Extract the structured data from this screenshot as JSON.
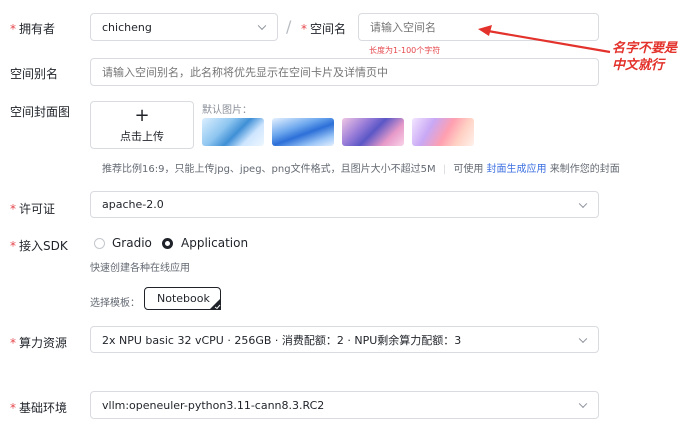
{
  "owner": {
    "label": "拥有者",
    "value": "chicheng",
    "separator": "/"
  },
  "space_name": {
    "label": "空间名",
    "placeholder": "请输入空间名",
    "length_hint": "长度为1-100个字符"
  },
  "annotation": {
    "text_line1": "名字不要是",
    "text_line2": "中文就行",
    "color": "#e3322b"
  },
  "alias": {
    "label": "空间别名",
    "placeholder": "请输入空间别名，此名称将优先显示在空间卡片及详情页中"
  },
  "cover": {
    "label": "空间封面图",
    "upload_plus": "+",
    "upload_label": "点击上传",
    "default_label": "默认图片：",
    "hint": "推荐比例16:9，只能上传jpg、jpeg、png文件格式，且图片大小不超过5M",
    "hint_prefix": "可使用",
    "hint_link": "封面生成应用",
    "hint_suffix": "来制作您的封面",
    "link_color": "#3b6fe0"
  },
  "license": {
    "label": "许可证",
    "value": "apache-2.0"
  },
  "sdk": {
    "label": "接入SDK",
    "options": [
      "Gradio",
      "Application"
    ],
    "selected": "Application",
    "description": "快速创建各种在线应用",
    "template_label": "选择模板：",
    "template_value": "Notebook"
  },
  "compute": {
    "label": "算力资源",
    "value": "2x NPU basic 32 vCPU · 256GB · 消费配额：2 · NPU剩余算力配额：3"
  },
  "env": {
    "label": "基础环境",
    "value": "vllm:openeuler-python3.11-cann8.3.RC2"
  },
  "required_color": "#e5484d"
}
